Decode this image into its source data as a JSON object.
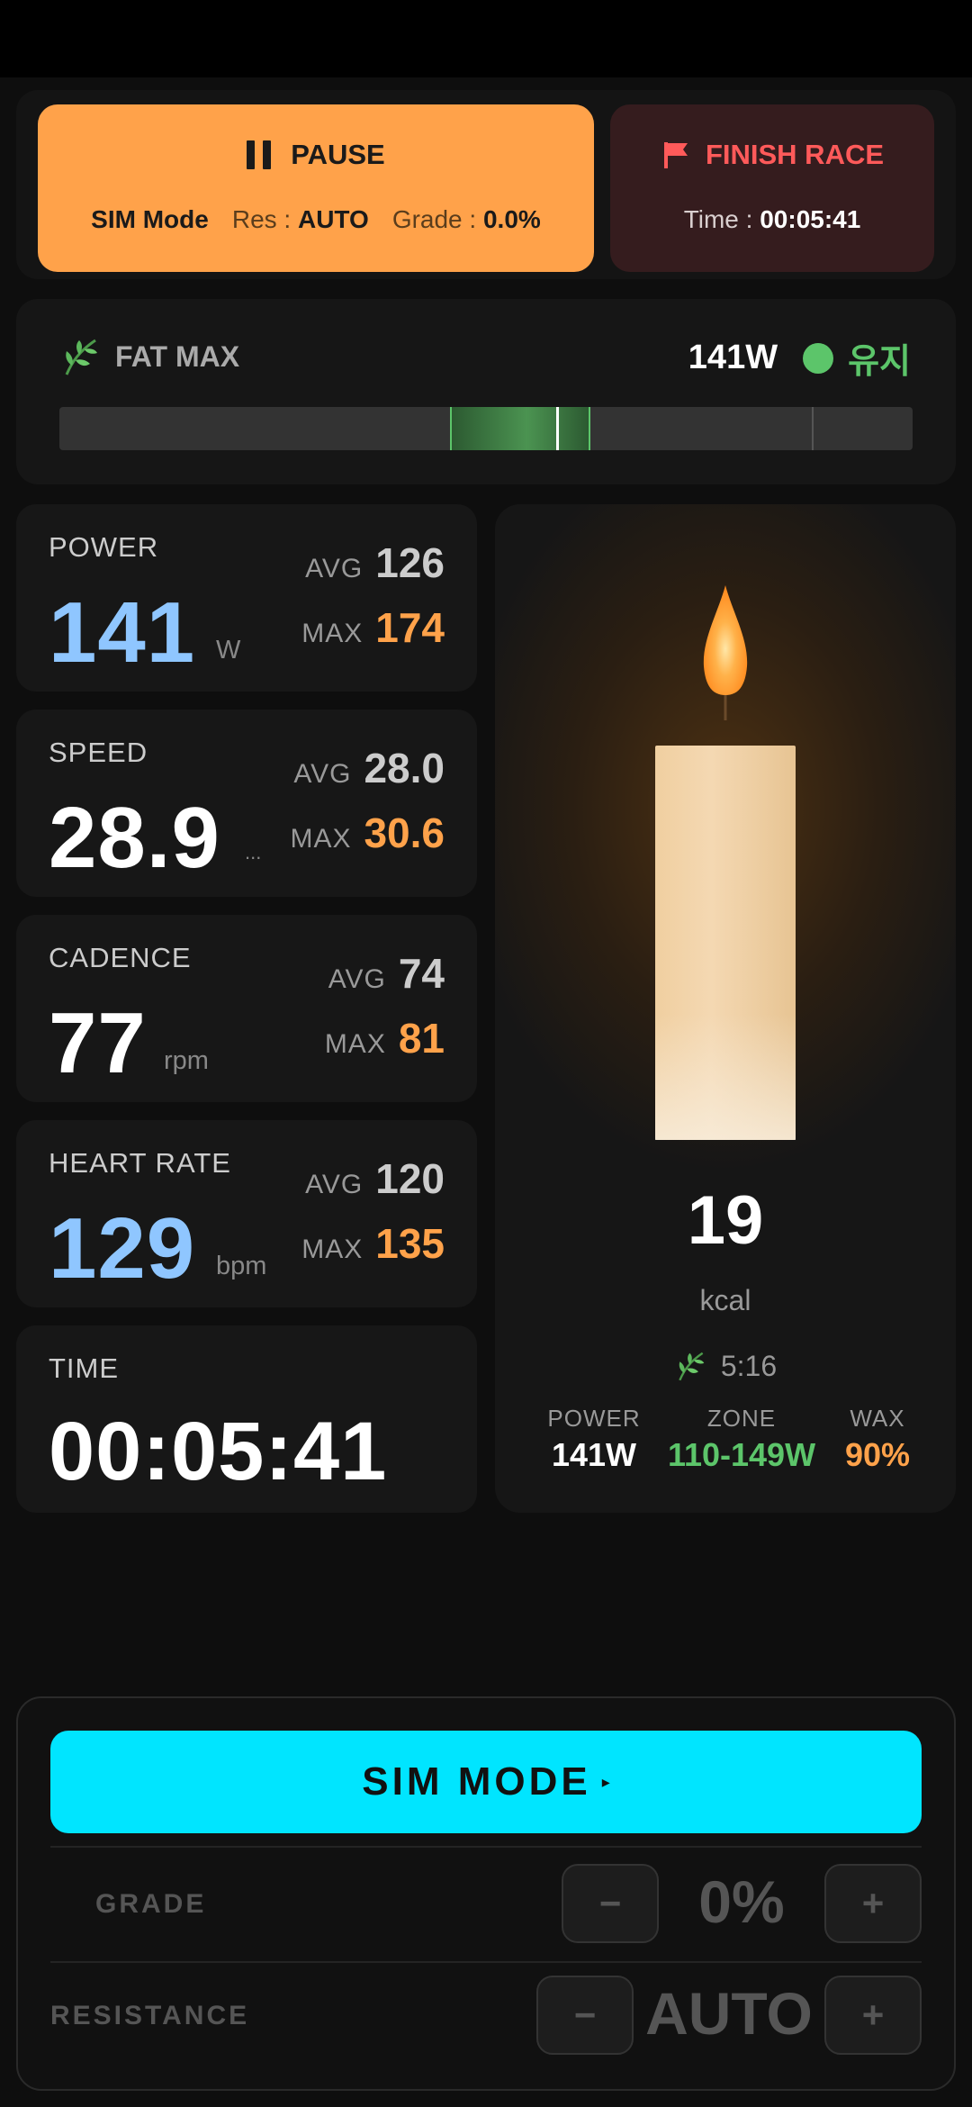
{
  "top": {
    "pause_label": "PAUSE",
    "mode": "SIM Mode",
    "res_key": "Res :",
    "res_value": "AUTO",
    "grade_key": "Grade :",
    "grade_value": "0.0%",
    "finish_label": "FINISH RACE",
    "time_key": "Time :",
    "time_value": "00:05:41"
  },
  "fatmax": {
    "label": "FAT MAX",
    "power": "141W",
    "status": "유지",
    "status_color": "#5cc56a"
  },
  "metrics": {
    "power": {
      "label": "POWER",
      "value": "141",
      "unit": "W",
      "avg_key": "AVG",
      "avg": "126",
      "max_key": "MAX",
      "max": "174"
    },
    "speed": {
      "label": "SPEED",
      "value": "28.9",
      "unit": "...",
      "avg_key": "AVG",
      "avg": "28.0",
      "max_key": "MAX",
      "max": "30.6"
    },
    "cadence": {
      "label": "CADENCE",
      "value": "77",
      "unit": "rpm",
      "avg_key": "AVG",
      "avg": "74",
      "max_key": "MAX",
      "max": "81"
    },
    "heart": {
      "label": "HEART RATE",
      "value": "129",
      "unit": "bpm",
      "avg_key": "AVG",
      "avg": "120",
      "max_key": "MAX",
      "max": "135"
    },
    "time": {
      "label": "TIME",
      "value": "00:05:41"
    }
  },
  "candle": {
    "kcal": "19",
    "kcal_unit": "kcal",
    "leaf_time": "5:16",
    "power_key": "POWER",
    "power_val": "141W",
    "zone_key": "ZONE",
    "zone_val": "110-149W",
    "wax_key": "WAX",
    "wax_val": "90%"
  },
  "control": {
    "sim_button": "SIM MODE",
    "grade_label": "GRADE",
    "grade_value": "0%",
    "resistance_label": "RESISTANCE",
    "resistance_value": "AUTO",
    "minus": "−",
    "plus": "+"
  },
  "colors": {
    "accent_orange": "#ffa24a",
    "accent_cyan": "#00e5ff",
    "accent_blue": "#8fc6ff",
    "accent_green": "#5cc56a",
    "finish_red": "#ff5a5a"
  },
  "icons": [
    "pause-icon",
    "flag-icon",
    "leaf-icon",
    "flame-icon",
    "status-dot-icon"
  ]
}
